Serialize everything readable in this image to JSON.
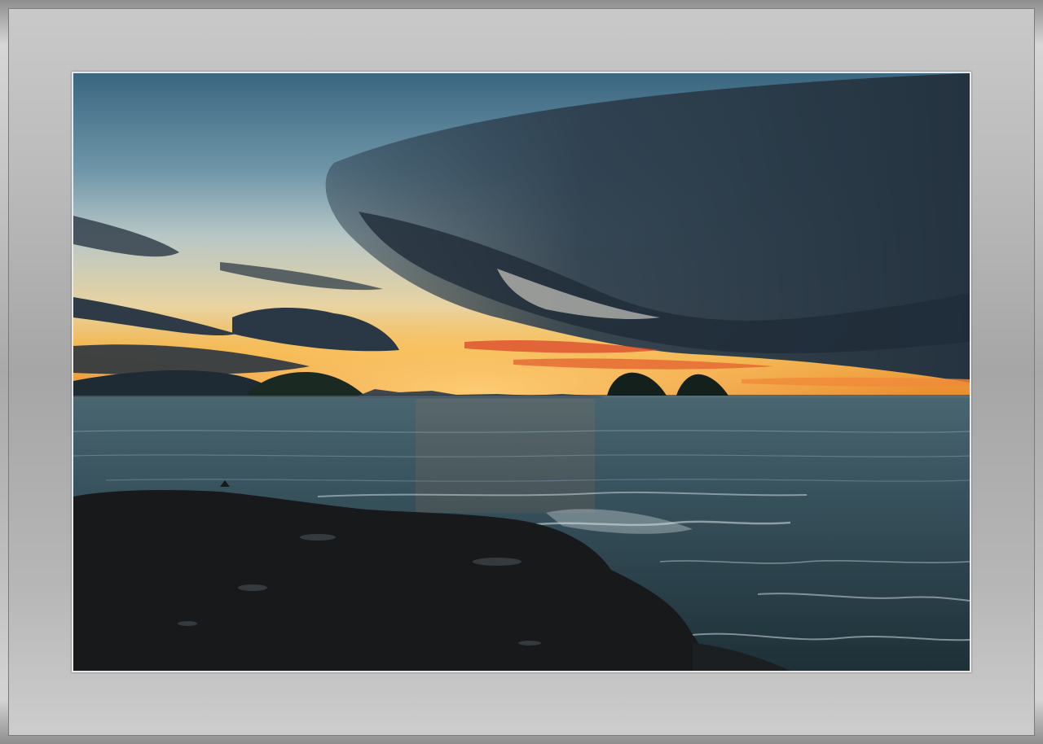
{
  "scene": {
    "subject": "sunset-seascape",
    "colors": {
      "sky_top": "#3d6680",
      "sky_mid": "#9fb7c2",
      "horizon_glow": "#f2a93a",
      "horizon_red": "#d9452a",
      "cloud_dark": "#2a3b4a",
      "sea": "#33505c",
      "rock": "#16191c",
      "frame_gray": "#b0b0b0"
    }
  }
}
